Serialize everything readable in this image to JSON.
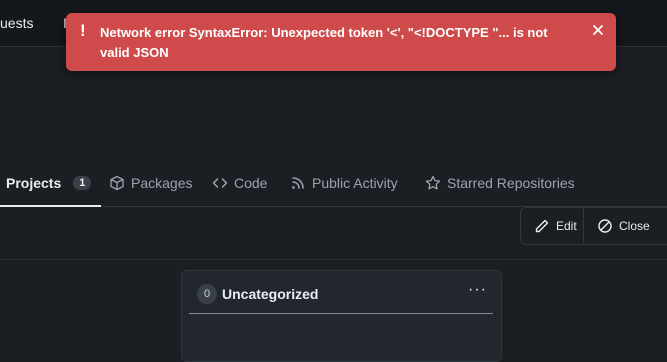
{
  "topnav": {
    "items": [
      "uests",
      "I"
    ]
  },
  "toast": {
    "message": "Network error SyntaxError: Unexpected token '<', \"<!DOCTYPE \"... is not valid JSON",
    "icons": {
      "alert": "exclamation-icon",
      "close": "close-icon"
    }
  },
  "tabs": [
    {
      "label": "Projects",
      "count": "1",
      "active": true
    },
    {
      "label": "Packages",
      "icon": "package-icon"
    },
    {
      "label": "Code",
      "icon": "code-icon"
    },
    {
      "label": "Public Activity",
      "icon": "rss-icon"
    },
    {
      "label": "Starred Repositories",
      "icon": "star-icon"
    }
  ],
  "toolbar": {
    "edit_label": "Edit",
    "close_label": "Close"
  },
  "column": {
    "count": "0",
    "title": "Uncategorized",
    "menu": "···"
  },
  "colors": {
    "toast_bg": "#cf4b4b",
    "page_bg": "#1b1f24"
  }
}
